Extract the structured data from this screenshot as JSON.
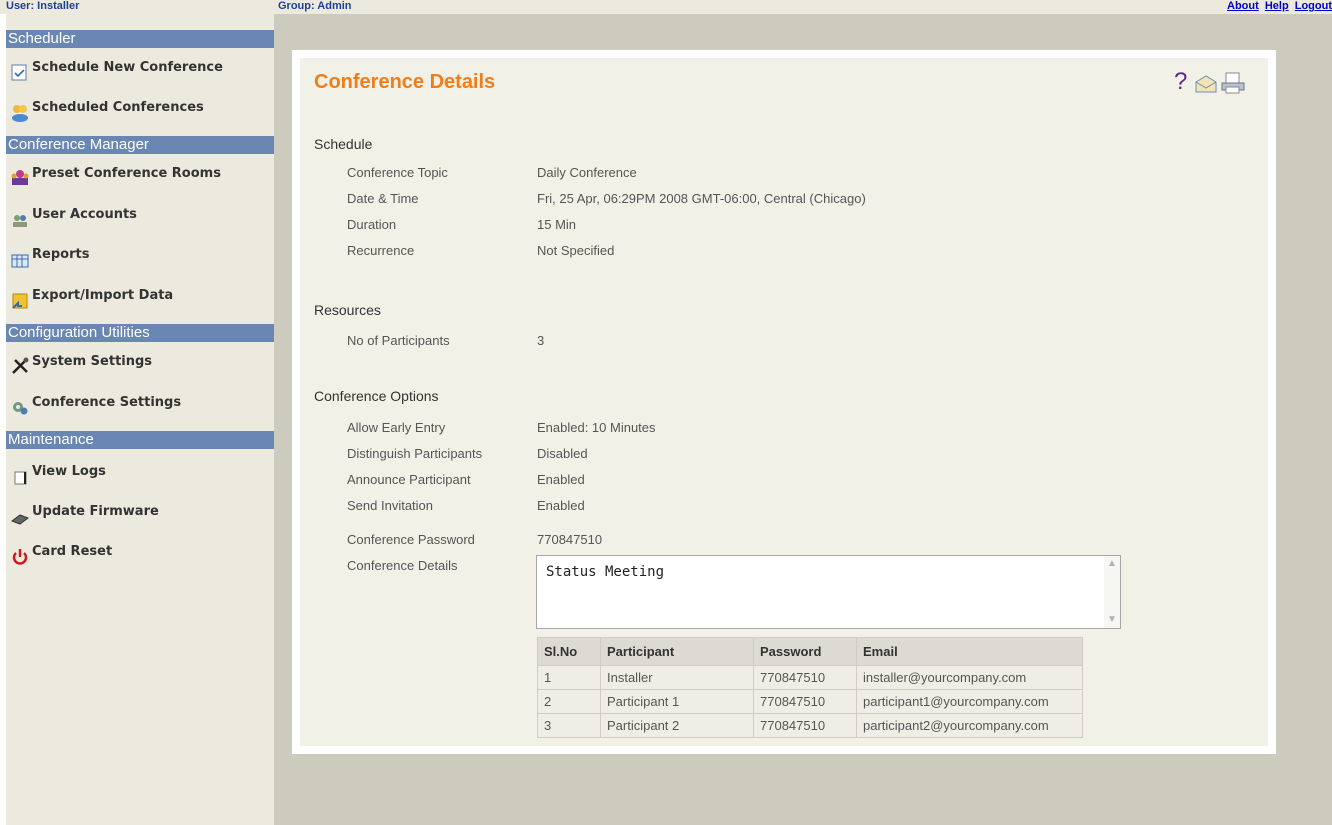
{
  "topbar": {
    "user": "User: Installer",
    "group": "Group: Admin",
    "links": [
      "About",
      "Help",
      "Logout"
    ]
  },
  "sidebar": {
    "sections": [
      {
        "title": "Scheduler",
        "items": [
          "Schedule New Conference",
          "Scheduled Conferences"
        ]
      },
      {
        "title": "Conference Manager",
        "items": [
          "Preset Conference Rooms",
          "User Accounts",
          "Reports",
          "Export/Import Data"
        ]
      },
      {
        "title": "Configuration Utilities",
        "items": [
          "System Settings",
          "Conference Settings"
        ]
      },
      {
        "title": "Maintenance",
        "items": [
          "View Logs",
          "Update Firmware",
          "Card Reset"
        ]
      }
    ]
  },
  "toolbar": {
    "help_glyph": "?"
  },
  "main": {
    "title": "Conference Details",
    "schedule": {
      "heading": "Schedule",
      "rows": [
        {
          "label": "Conference Topic",
          "value": "Daily Conference"
        },
        {
          "label": "Date & Time",
          "value": "Fri, 25 Apr, 06:29PM 2008 GMT-06:00, Central (Chicago)"
        },
        {
          "label": "Duration",
          "value": "15 Min"
        },
        {
          "label": "Recurrence",
          "value": "Not Specified"
        }
      ]
    },
    "resources": {
      "heading": "Resources",
      "rows": [
        {
          "label": "No of Participants",
          "value": "3"
        }
      ]
    },
    "options": {
      "heading": "Conference Options",
      "rows": [
        {
          "label": "Allow Early Entry",
          "value": "Enabled: 10 Minutes"
        },
        {
          "label": "Distinguish Participants",
          "value": "Disabled"
        },
        {
          "label": "Announce Participant",
          "value": "Enabled"
        },
        {
          "label": "Send Invitation",
          "value": "Enabled"
        },
        {
          "label": "Conference Password",
          "value": "770847510"
        }
      ],
      "details_label": "Conference Details",
      "details_value": "Status Meeting"
    },
    "participants": {
      "headers": [
        "Sl.No",
        "Participant",
        "Password",
        "Email"
      ],
      "rows": [
        [
          "1",
          "Installer",
          "770847510",
          "installer@yourcompany.com"
        ],
        [
          "2",
          "Participant 1",
          "770847510",
          "participant1@yourcompany.com"
        ],
        [
          "3",
          "Participant 2",
          "770847510",
          "participant2@yourcompany.com"
        ]
      ]
    }
  },
  "colors": {
    "accent_title": "#ef7d1a",
    "section_bar": "#6a87b3",
    "topbar_text": "#1f3f9a"
  }
}
